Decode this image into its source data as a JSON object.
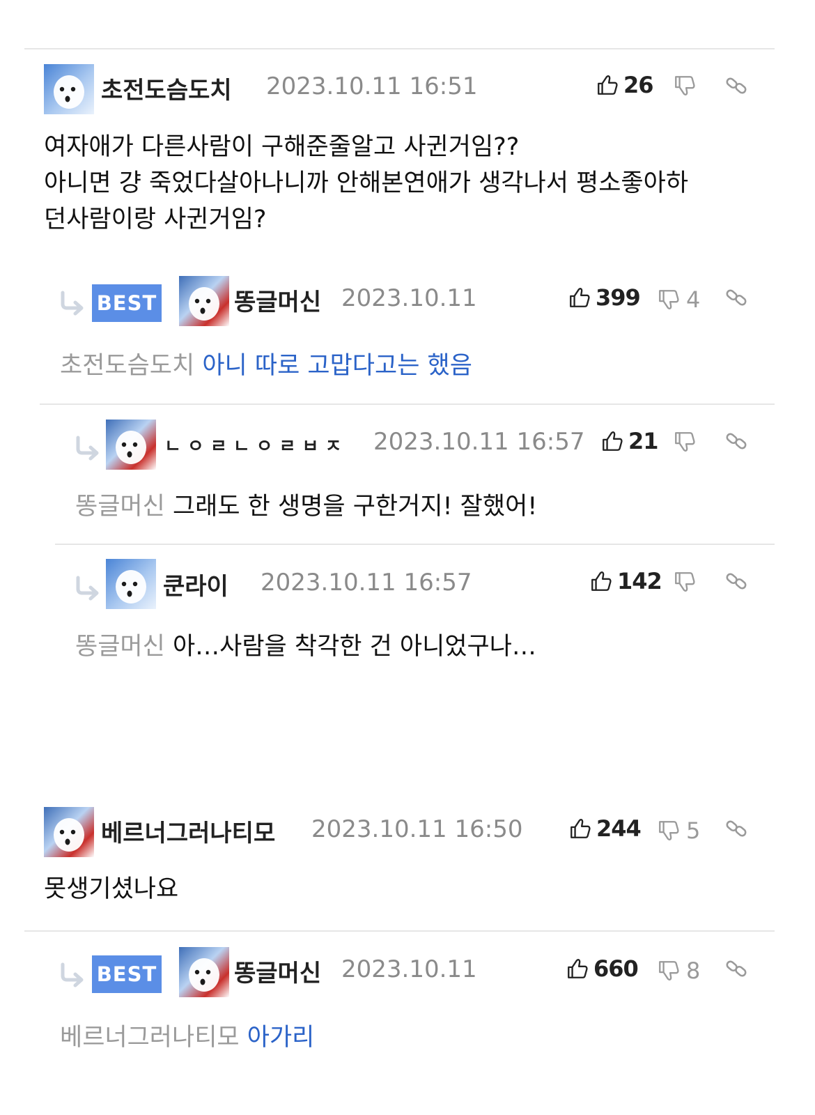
{
  "comments": [
    {
      "nickname": "초전도슴도치",
      "date": "2023.10.11 16:51",
      "likes": "26",
      "body_lines": [
        "여자애가 다른사람이 구해준줄알고 사귄거임??",
        "아니면 걍 죽었다살아나니까 안해본연애가 생각나서 평소좋아하",
        "던사람이랑 사귄거임?"
      ],
      "replies": [
        {
          "badge": "BEST",
          "nickname": "똥글머신",
          "date": "2023.10.11",
          "likes": "399",
          "dislikes": "4",
          "mention": "초전도슴도치",
          "text": "아니 따로 고맙다고는 했음"
        },
        {
          "nickname": "ㄴㅇㄹㄴㅇㄹㅂㅈ",
          "date": "2023.10.11 16:57",
          "likes": "21",
          "mention": "똥글머신",
          "text": "그래도 한 생명을 구한거지! 잘했어!"
        },
        {
          "nickname": "쿤라이",
          "date": "2023.10.11 16:57",
          "likes": "142",
          "mention": "똥글머신",
          "text": "아…사람을 착각한 건 아니었구나…"
        }
      ]
    },
    {
      "nickname": "베르너그러나티모",
      "date": "2023.10.11 16:50",
      "likes": "244",
      "dislikes": "5",
      "body_lines": [
        "못생기셨나요"
      ],
      "replies": [
        {
          "badge": "BEST",
          "nickname": "똥글머신",
          "date": "2023.10.11",
          "likes": "660",
          "dislikes": "8",
          "mention": "베르너그러나티모",
          "text": "아가리"
        }
      ]
    }
  ],
  "colors": {
    "best_badge": "#5b8ee6",
    "reply_link": "#2b63c8",
    "meta_gray": "#8a8a8a",
    "divider": "#e6e6e6"
  },
  "icons": [
    "thumbs-up-icon",
    "thumbs-down-icon",
    "link-icon",
    "reply-arrow-icon",
    "avatar-image"
  ]
}
